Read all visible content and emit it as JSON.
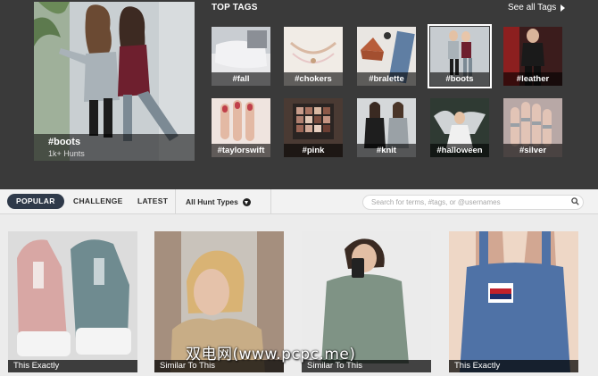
{
  "featured": {
    "tag": "#boots",
    "hunts": "1k+ Hunts"
  },
  "top_tags": {
    "title": "TOP TAGS",
    "see_all": "See all Tags",
    "items": [
      {
        "label": "#fall"
      },
      {
        "label": "#chokers"
      },
      {
        "label": "#bralette"
      },
      {
        "label": "#boots",
        "selected": true
      },
      {
        "label": "#leather"
      },
      {
        "label": "#taylorswift"
      },
      {
        "label": "#pink"
      },
      {
        "label": "#knit"
      },
      {
        "label": "#halloween"
      },
      {
        "label": "#silver"
      }
    ]
  },
  "filters": {
    "tabs": [
      {
        "label": "POPULAR",
        "active": true
      },
      {
        "label": "CHALLENGE"
      },
      {
        "label": "LATEST"
      }
    ],
    "hunt_types": "All Hunt Types",
    "search_placeholder": "Search for terms, #tags, or @usernames"
  },
  "results": [
    {
      "caption": "This Exactly"
    },
    {
      "caption": "Similar To This"
    },
    {
      "caption": "Similar To This"
    },
    {
      "caption": "This Exactly"
    }
  ],
  "watermark": "双电网(www.pcpc.me)"
}
